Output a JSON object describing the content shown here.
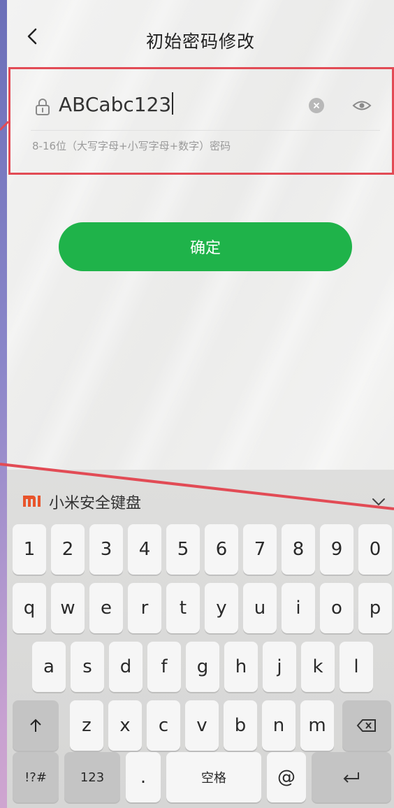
{
  "header": {
    "title": "初始密码修改"
  },
  "password": {
    "value": "ABCabc123",
    "hint": "8-16位（大写字母+小写字母+数字）密码"
  },
  "confirm_label": "确定",
  "keyboard": {
    "name": "小米安全键盘",
    "row1": [
      "1",
      "2",
      "3",
      "4",
      "5",
      "6",
      "7",
      "8",
      "9",
      "0"
    ],
    "row2": [
      "q",
      "w",
      "e",
      "r",
      "t",
      "y",
      "u",
      "i",
      "o",
      "p"
    ],
    "row3": [
      "a",
      "s",
      "d",
      "f",
      "g",
      "h",
      "j",
      "k",
      "l"
    ],
    "row4": [
      "z",
      "x",
      "c",
      "v",
      "b",
      "n",
      "m"
    ],
    "symbols_label": "!?#",
    "numbers_label": "123",
    "period_label": ".",
    "space_label": "空格",
    "at_label": "@"
  },
  "colors": {
    "accent_green": "#1fb34a",
    "annotation_red": "#e24b55",
    "mi_orange": "#e8542b"
  },
  "icons": [
    "back-icon",
    "lock-icon",
    "clear-icon",
    "eye-icon",
    "chevron-down-icon",
    "shift-icon",
    "backspace-icon",
    "enter-icon"
  ]
}
